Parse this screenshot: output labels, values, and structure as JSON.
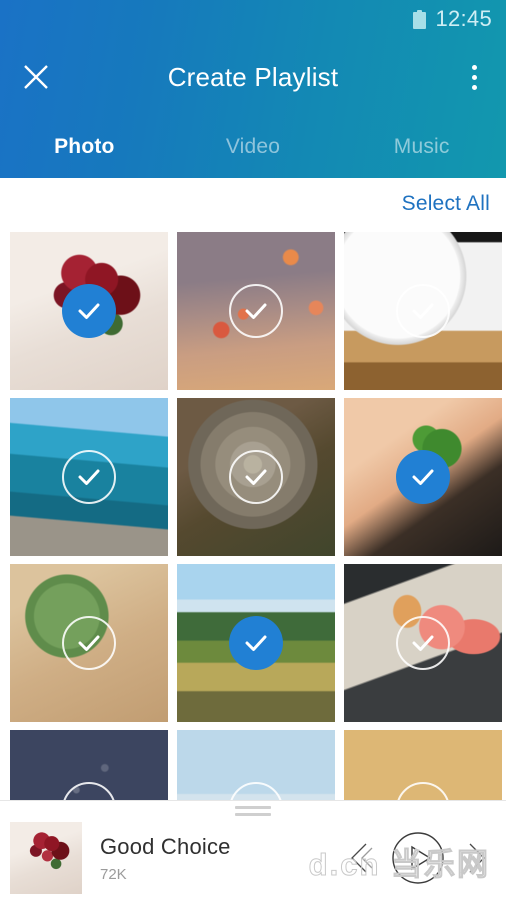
{
  "statusbar": {
    "time": "12:45",
    "battery_icon": "battery-icon"
  },
  "header": {
    "title": "Create Playlist",
    "close_icon": "close-icon",
    "overflow_icon": "overflow-menu-icon",
    "gradient_start": "#1a72c6",
    "gradient_end": "#1298ae",
    "tabs": [
      {
        "label": "Photo",
        "active": true
      },
      {
        "label": "Video",
        "active": false
      },
      {
        "label": "Music",
        "active": false
      }
    ]
  },
  "toolbar": {
    "select_all_label": "Select All",
    "select_all_color": "#1f72c0"
  },
  "grid": {
    "selected_color": "#2180d4",
    "items": [
      {
        "name": "photo-bouquet",
        "art": "im-bouquet",
        "selected": true
      },
      {
        "name": "photo-balloons",
        "art": "im-balloons",
        "selected": false
      },
      {
        "name": "photo-clock",
        "art": "im-clock",
        "selected": false
      },
      {
        "name": "photo-seaside",
        "art": "im-sea",
        "selected": false
      },
      {
        "name": "photo-stump",
        "art": "im-stump",
        "selected": false
      },
      {
        "name": "photo-clover",
        "art": "im-clover",
        "selected": true
      },
      {
        "name": "photo-plant",
        "art": "im-plant",
        "selected": false
      },
      {
        "name": "photo-field",
        "art": "im-field",
        "selected": true
      },
      {
        "name": "photo-sushi",
        "art": "im-sushi",
        "selected": false
      },
      {
        "name": "photo-startrail",
        "art": "im-stars",
        "selected": false
      },
      {
        "name": "photo-sky",
        "art": "im-sky",
        "selected": false
      },
      {
        "name": "photo-sand",
        "art": "im-sand",
        "selected": false
      }
    ]
  },
  "player": {
    "drag_handle_icon": "drag-handle-icon",
    "thumbnail_art": "im-bouquet",
    "track_title": "Good Choice",
    "track_subtitle": "72K",
    "prev_icon": "previous-track-icon",
    "play_icon": "play-button-icon",
    "next_icon": "next-track-icon"
  },
  "watermark": {
    "text": "d.cn 当乐网"
  }
}
